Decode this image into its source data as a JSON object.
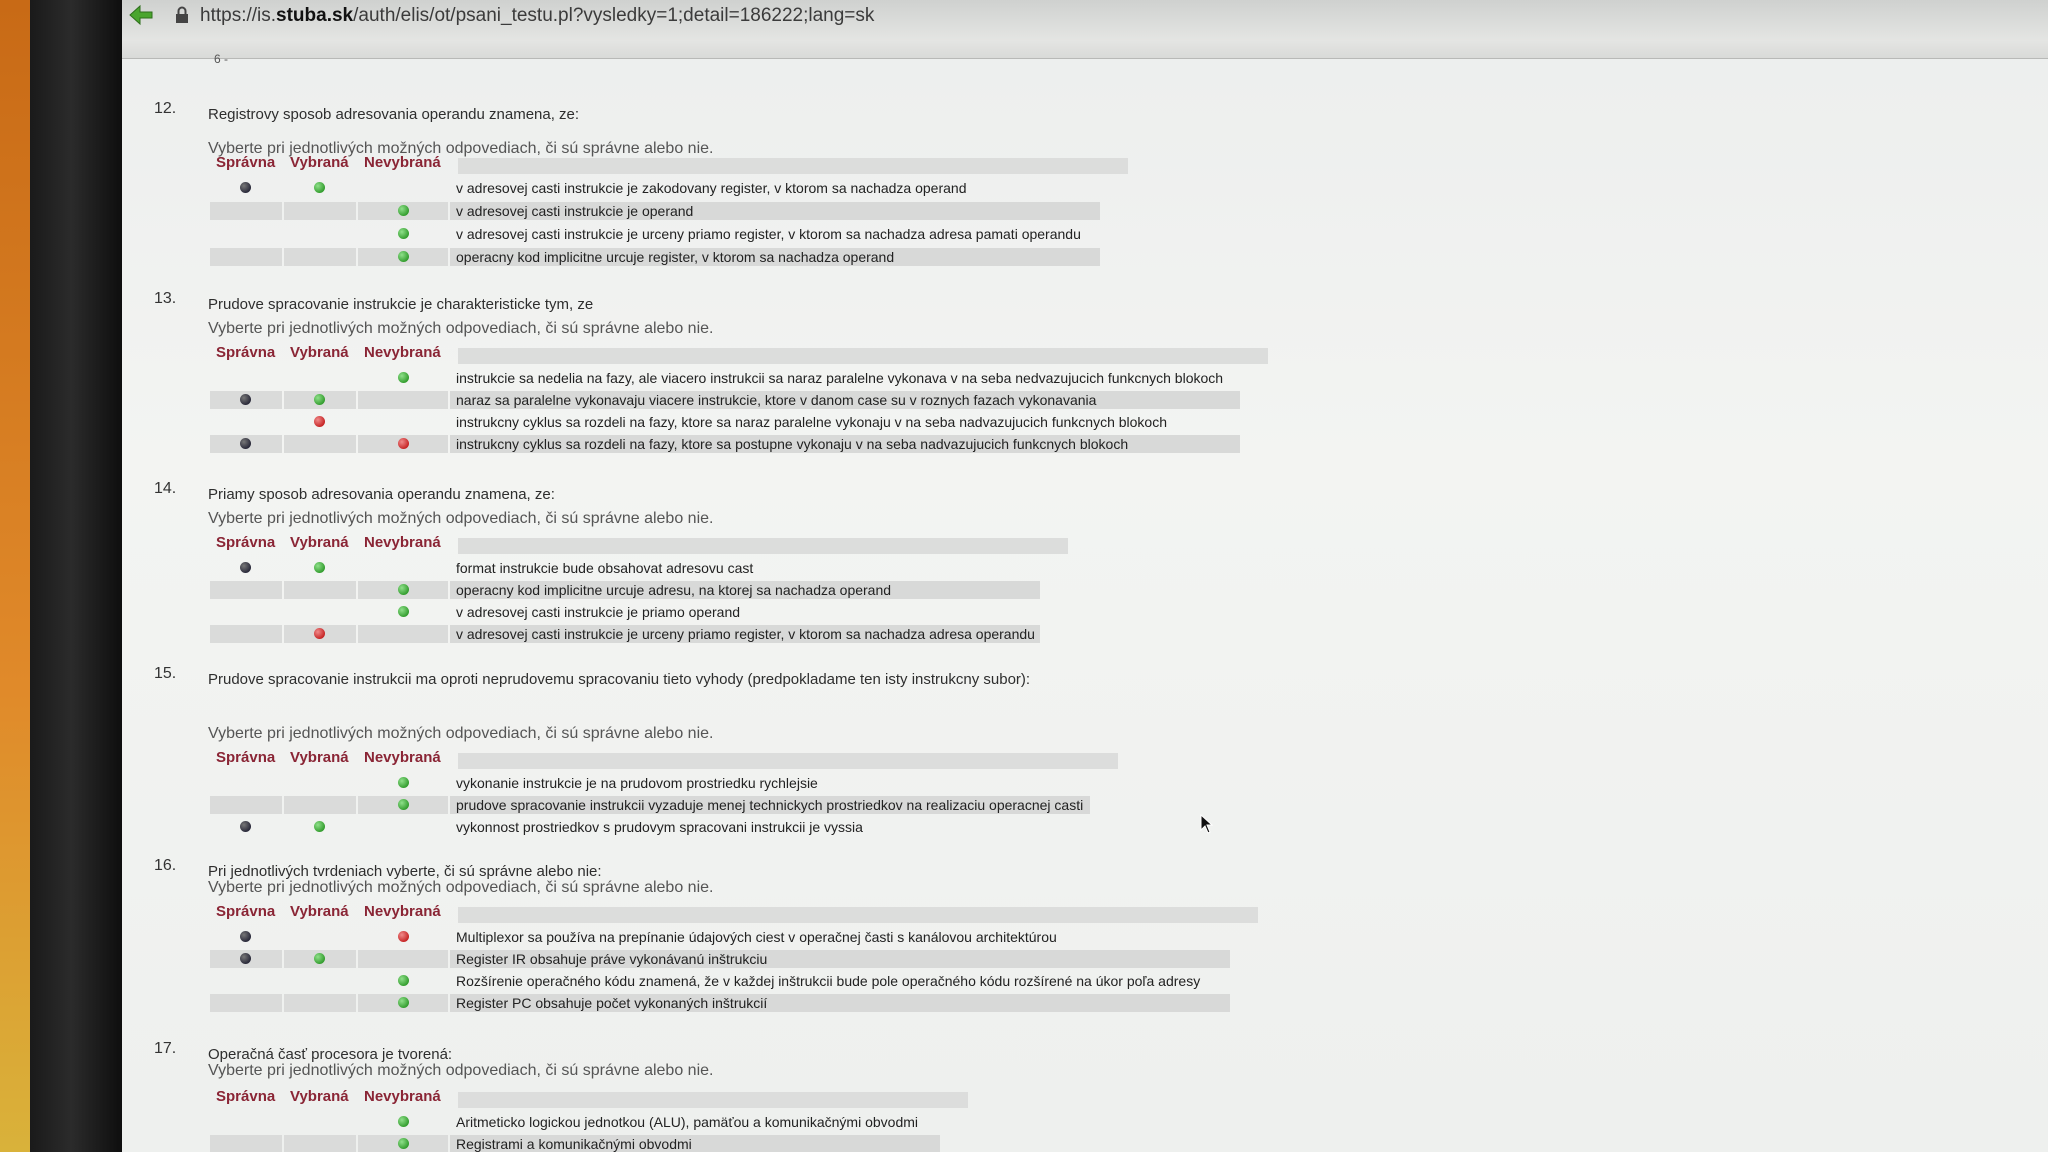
{
  "browser": {
    "url_prefix": "https://is.",
    "url_domain": "stuba.sk",
    "url_path": "/auth/elis/ot/psani_testu.pl?vysledky=1;detail=186222;lang=sk"
  },
  "top_fragment": "6 -",
  "columns": {
    "correct": "Správna",
    "selected": "Vybraná",
    "unselected": "Nevybraná"
  },
  "instruction": "Vyberte pri jednotlivých možných odpovediach, či sú správne alebo nie.",
  "questions": [
    {
      "number": "12.",
      "text": "Registrovy sposob adresovania operandu znamena, ze:",
      "answers": [
        {
          "text": "v adresovej casti instrukcie je zakodovany register, v ktorom sa nachadza operand",
          "correct": "dark",
          "selected": "green",
          "unselected": ""
        },
        {
          "text": "v adresovej casti instrukcie je operand",
          "correct": "",
          "selected": "",
          "unselected": "green"
        },
        {
          "text": "v adresovej casti instrukcie je urceny priamo register, v ktorom sa nachadza adresa pamati operandu",
          "correct": "",
          "selected": "",
          "unselected": "green"
        },
        {
          "text": "operacny kod implicitne urcuje register, v ktorom sa nachadza operand",
          "correct": "",
          "selected": "",
          "unselected": "green"
        }
      ]
    },
    {
      "number": "13.",
      "text": "Prudove spracovanie instrukcie je charakteristicke tym, ze",
      "answers": [
        {
          "text": "instrukcie sa nedelia na fazy, ale viacero instrukcii sa naraz paralelne vykonava v na seba nedvazujucich funkcnych blokoch",
          "correct": "",
          "selected": "",
          "unselected": "green"
        },
        {
          "text": "naraz sa paralelne vykonavaju viacere instrukcie, ktore v danom case su v roznych fazach vykonavania",
          "correct": "dark",
          "selected": "green",
          "unselected": ""
        },
        {
          "text": "instrukcny cyklus sa rozdeli na fazy, ktore sa naraz paralelne vykonaju v na seba nadvazujucich funkcnych blokoch",
          "correct": "",
          "selected": "red",
          "unselected": ""
        },
        {
          "text": "instrukcny cyklus sa rozdeli na fazy, ktore sa postupne vykonaju v na seba nadvazujucich funkcnych blokoch",
          "correct": "dark",
          "selected": "",
          "unselected": "red"
        }
      ]
    },
    {
      "number": "14.",
      "text": "Priamy sposob adresovania operandu znamena, ze:",
      "answers": [
        {
          "text": "format instrukcie bude obsahovat adresovu cast",
          "correct": "dark",
          "selected": "green",
          "unselected": ""
        },
        {
          "text": "operacny kod implicitne urcuje adresu, na ktorej sa nachadza operand",
          "correct": "",
          "selected": "",
          "unselected": "green"
        },
        {
          "text": "v adresovej casti instrukcie je priamo operand",
          "correct": "",
          "selected": "",
          "unselected": "green"
        },
        {
          "text": "v adresovej casti instrukcie je urceny priamo register, v ktorom sa nachadza adresa operandu",
          "correct": "",
          "selected": "red",
          "unselected": ""
        }
      ]
    },
    {
      "number": "15.",
      "text": "Prudove spracovanie instrukcii ma oproti neprudovemu spracovaniu tieto vyhody (predpokladame ten isty instrukcny subor):",
      "answers": [
        {
          "text": "vykonanie instrukcie je na prudovom prostriedku rychlejsie",
          "correct": "",
          "selected": "",
          "unselected": "green"
        },
        {
          "text": "prudove spracovanie instrukcii vyzaduje menej technickych prostriedkov na realizaciu operacnej casti",
          "correct": "",
          "selected": "",
          "unselected": "green"
        },
        {
          "text": "vykonnost prostriedkov s prudovym spracovani instrukcii je vyssia",
          "correct": "dark",
          "selected": "green",
          "unselected": ""
        }
      ]
    },
    {
      "number": "16.",
      "text": "Pri jednotlivých tvrdeniach vyberte, či sú správne alebo nie:",
      "answers": [
        {
          "text": "Multiplexor sa používa na prepínanie údajových ciest v operačnej časti s kanálovou architektúrou",
          "correct": "dark",
          "selected": "",
          "unselected": "red"
        },
        {
          "text": "Register IR obsahuje práve vykonávanú inštrukciu",
          "correct": "dark",
          "selected": "green",
          "unselected": ""
        },
        {
          "text": "Rozšírenie operačného kódu znamená, že v každej inštrukcii bude pole operačného kódu rozšírené na úkor poľa adresy",
          "correct": "",
          "selected": "",
          "unselected": "green"
        },
        {
          "text": "Register PC obsahuje počet vykonaných inštrukcií",
          "correct": "",
          "selected": "",
          "unselected": "green"
        }
      ]
    },
    {
      "number": "17.",
      "text": "Operačná časť procesora je tvorená:",
      "answers": [
        {
          "text": "Aritmeticko logickou jednotkou (ALU), pamäťou a komunikačnými obvodmi",
          "correct": "",
          "selected": "",
          "unselected": "green"
        },
        {
          "text": "Registrami a komunikačnými obvodmi",
          "correct": "",
          "selected": "",
          "unselected": "green"
        }
      ]
    }
  ]
}
